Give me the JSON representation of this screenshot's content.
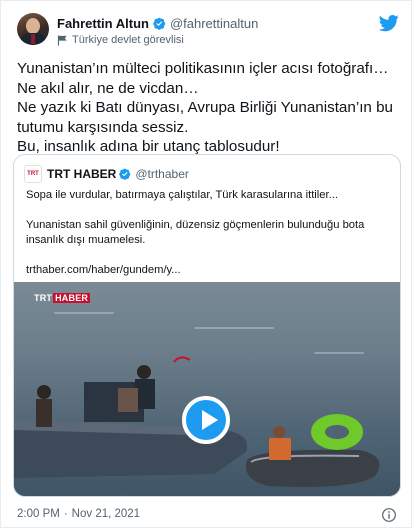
{
  "author": {
    "name": "Fahrettin Altun",
    "handle": "@fahrettinaltun",
    "label": "Türkiye devlet görevlisi"
  },
  "tweet": {
    "text": "Yunanistan’ın mülteci politikasının içler acısı fotoğrafı… Ne akıl alır, ne de vicdan…\nNe yazık ki Batı dünyası, Avrupa Birliği Yunanistan’ın bu tutumu karşısında sessiz.\nBu, insanlık adına bir utanç tablosudur!"
  },
  "quoted": {
    "logo_text": "TRT",
    "name": "TRT HABER",
    "handle": "@trthaber",
    "text": "Sopa ile vurdular, batırmaya çalıştılar, Türk karasularına ittiler...\n\nYunanistan sahil güvenliğinin, düzensiz göçmenlerin bulunduğu bota insanlık dışı muamelesi.\n\ntrthaber.com/haber/gundem/y...",
    "watermark_trt": "TRT",
    "watermark_haber": "HABER"
  },
  "footer": {
    "time": "2:00 PM",
    "separator": "·",
    "date": "Nov 21, 2021"
  },
  "icons": {
    "verified": "verified-badge-icon",
    "flag": "flag-icon",
    "brand": "twitter-bird-icon",
    "play": "play-icon",
    "info": "info-icon"
  },
  "colors": {
    "accent": "#1d9bf0",
    "trt_red": "#c8102e",
    "secondary_text": "#536471"
  }
}
